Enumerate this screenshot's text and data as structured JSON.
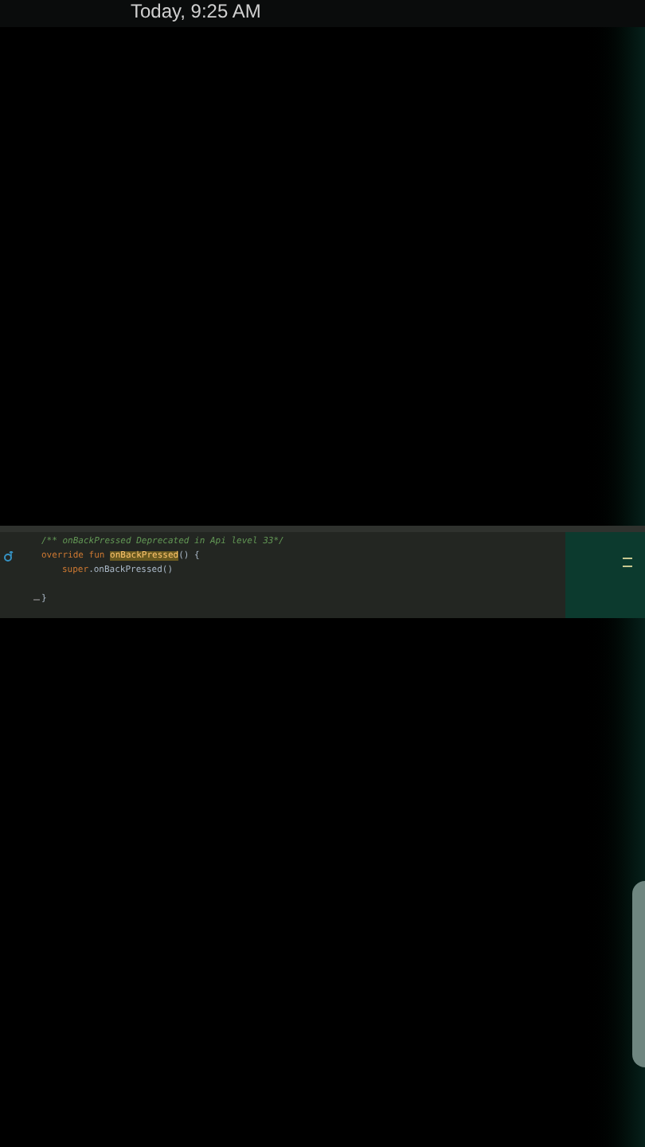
{
  "notification": {
    "time": "Today, 9:25 AM"
  },
  "editor": {
    "lines": [
      {
        "kind": "plain",
        "indented": false,
        "tokens": [
          {
            "text": "/** onBackPressed Deprecated in Api level 33*/",
            "kind": "comment"
          }
        ]
      },
      {
        "kind": "override",
        "indented": false,
        "tokens": [
          {
            "text": "override fun ",
            "kind": "keyword"
          },
          {
            "text": "onBackPressed",
            "kind": "highlight"
          },
          {
            "text": "() {",
            "kind": "plain"
          }
        ]
      },
      {
        "kind": "plain",
        "indented": true,
        "tokens": [
          {
            "text": "super",
            "kind": "keyword"
          },
          {
            "text": ".onBackPressed()",
            "kind": "plain"
          }
        ]
      },
      {
        "kind": "plain"
      },
      {
        "kind": "fold",
        "indented": false,
        "tokens": [
          {
            "text": "}",
            "kind": "plain"
          }
        ]
      }
    ]
  }
}
